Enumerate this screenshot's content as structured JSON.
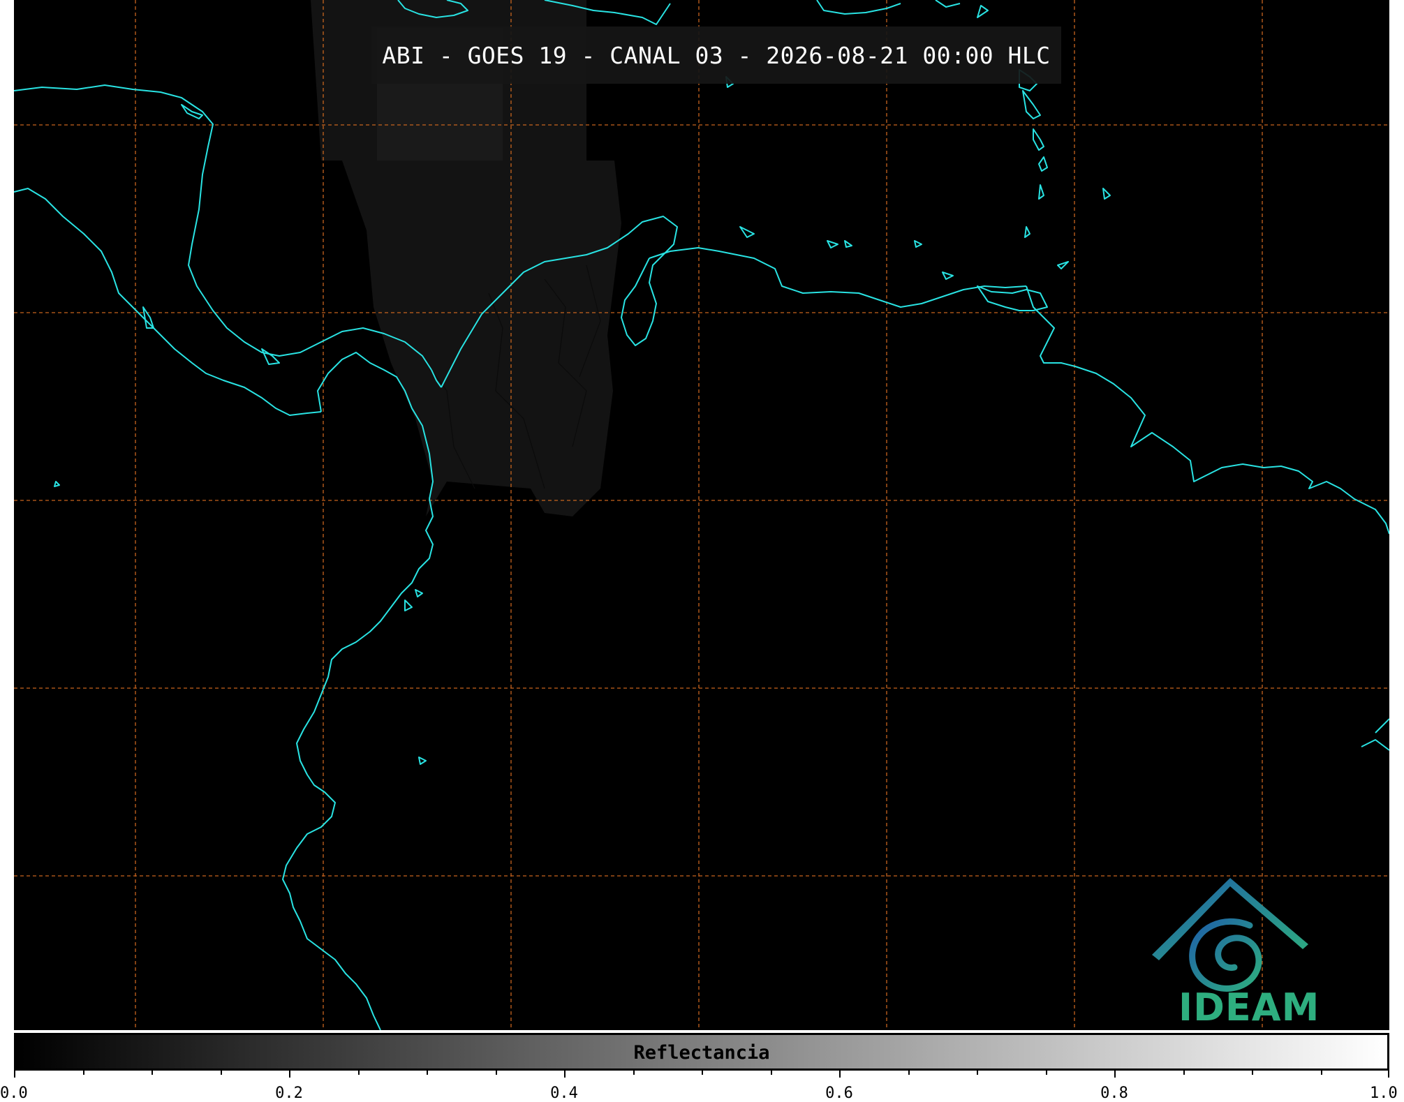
{
  "title": "ABI - GOES 19 - CANAL 03 - 2026-08-21 00:00 HLC",
  "colorbar": {
    "label": "Reflectancia",
    "range": [
      0.0,
      1.0
    ],
    "ticks": [
      "0.0",
      "0.2",
      "0.4",
      "0.6",
      "0.8",
      "1.0"
    ],
    "minor_step": 0.05
  },
  "logo": {
    "text": "IDEAM"
  },
  "colors": {
    "coastline": "#29e3e3",
    "graticule": "#c8641e",
    "background": "#000000"
  }
}
